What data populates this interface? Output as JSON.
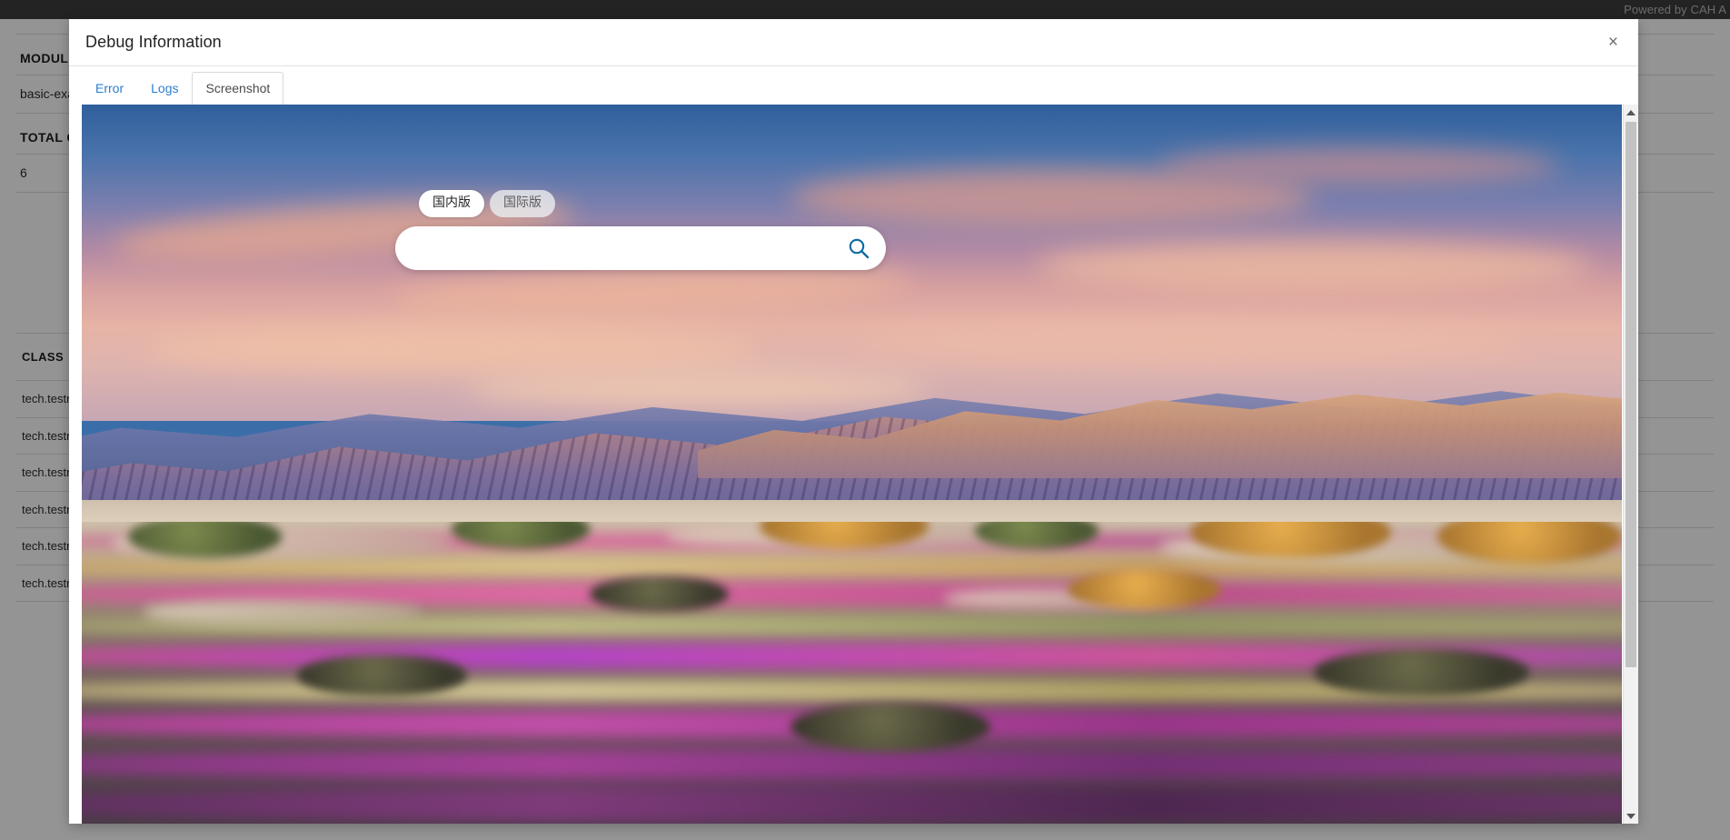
{
  "topbar": {
    "powered_by": "Powered by CAH A"
  },
  "background": {
    "summary": [
      {
        "label": "MODULE",
        "value": "basic-exam"
      },
      {
        "label": "TOTAL CASES",
        "value": "6"
      }
    ],
    "table": {
      "headers": [
        "CLASS"
      ],
      "rows": [
        {
          "cls": "tech.testnx\nicTests"
        },
        {
          "cls": "tech.testnx\nicTests"
        },
        {
          "cls": "tech.testnx\nicTests"
        },
        {
          "cls": "tech.testnx\nicTests"
        },
        {
          "cls": "tech.testnx\nicTests"
        },
        {
          "cls": "tech.testnx\nicTests"
        }
      ]
    }
  },
  "modal": {
    "title": "Debug Information",
    "close_label": "×",
    "tabs": [
      {
        "label": "Error",
        "active": false
      },
      {
        "label": "Logs",
        "active": false
      },
      {
        "label": "Screenshot",
        "active": true
      }
    ],
    "scrollbar": {
      "up_arrow": "▲",
      "down_arrow": "▼"
    }
  },
  "screenshot_content": {
    "description": "Desert wildflower landscape at sunset with mountain range",
    "version_tabs": [
      {
        "label": "国内版",
        "active": true
      },
      {
        "label": "国际版",
        "active": false
      }
    ],
    "search": {
      "value": "",
      "placeholder": "",
      "icon": "search-icon"
    }
  },
  "colors": {
    "topbar_bg": "#3d3d3d",
    "tab_link": "#2a7fd4",
    "search_icon": "#0b6ba5",
    "overlay": "rgba(0,0,0,0.42)",
    "modal_bg": "#ffffff"
  }
}
